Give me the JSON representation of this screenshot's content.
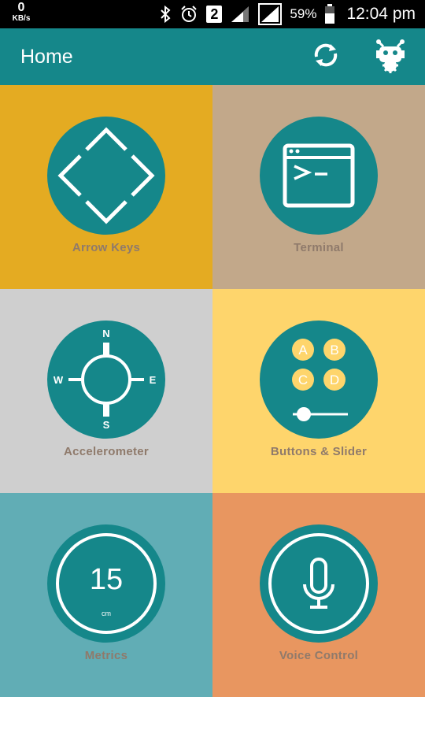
{
  "status_bar": {
    "speed_value": "0",
    "speed_unit": "KB/s",
    "sim_slot": "2",
    "battery": "59%",
    "time": "12:04 pm"
  },
  "app_bar": {
    "title": "Home",
    "color": "#15878a",
    "actions": [
      "refresh-icon",
      "robot-settings-icon"
    ]
  },
  "tiles": [
    {
      "label": "Arrow Keys",
      "color": "#e4ab22",
      "icon": "arrow-keys-icon"
    },
    {
      "label": "Terminal",
      "color": "#c2a88a",
      "icon": "terminal-icon"
    },
    {
      "label": "Accelerometer",
      "color": "#cfcfcf",
      "icon": "compass-icon",
      "compass": {
        "n": "N",
        "s": "S",
        "e": "E",
        "w": "W"
      }
    },
    {
      "label": "Buttons & Slider",
      "color": "#fed56c",
      "icon": "buttons-slider-icon",
      "buttons": [
        "A",
        "B",
        "C",
        "D"
      ]
    },
    {
      "label": "Metrics",
      "color": "#61adb5",
      "icon": "metrics-icon",
      "metric_value": "15",
      "metric_unit": "cm"
    },
    {
      "label": "Voice Control",
      "color": "#e89660",
      "icon": "microphone-icon"
    }
  ]
}
